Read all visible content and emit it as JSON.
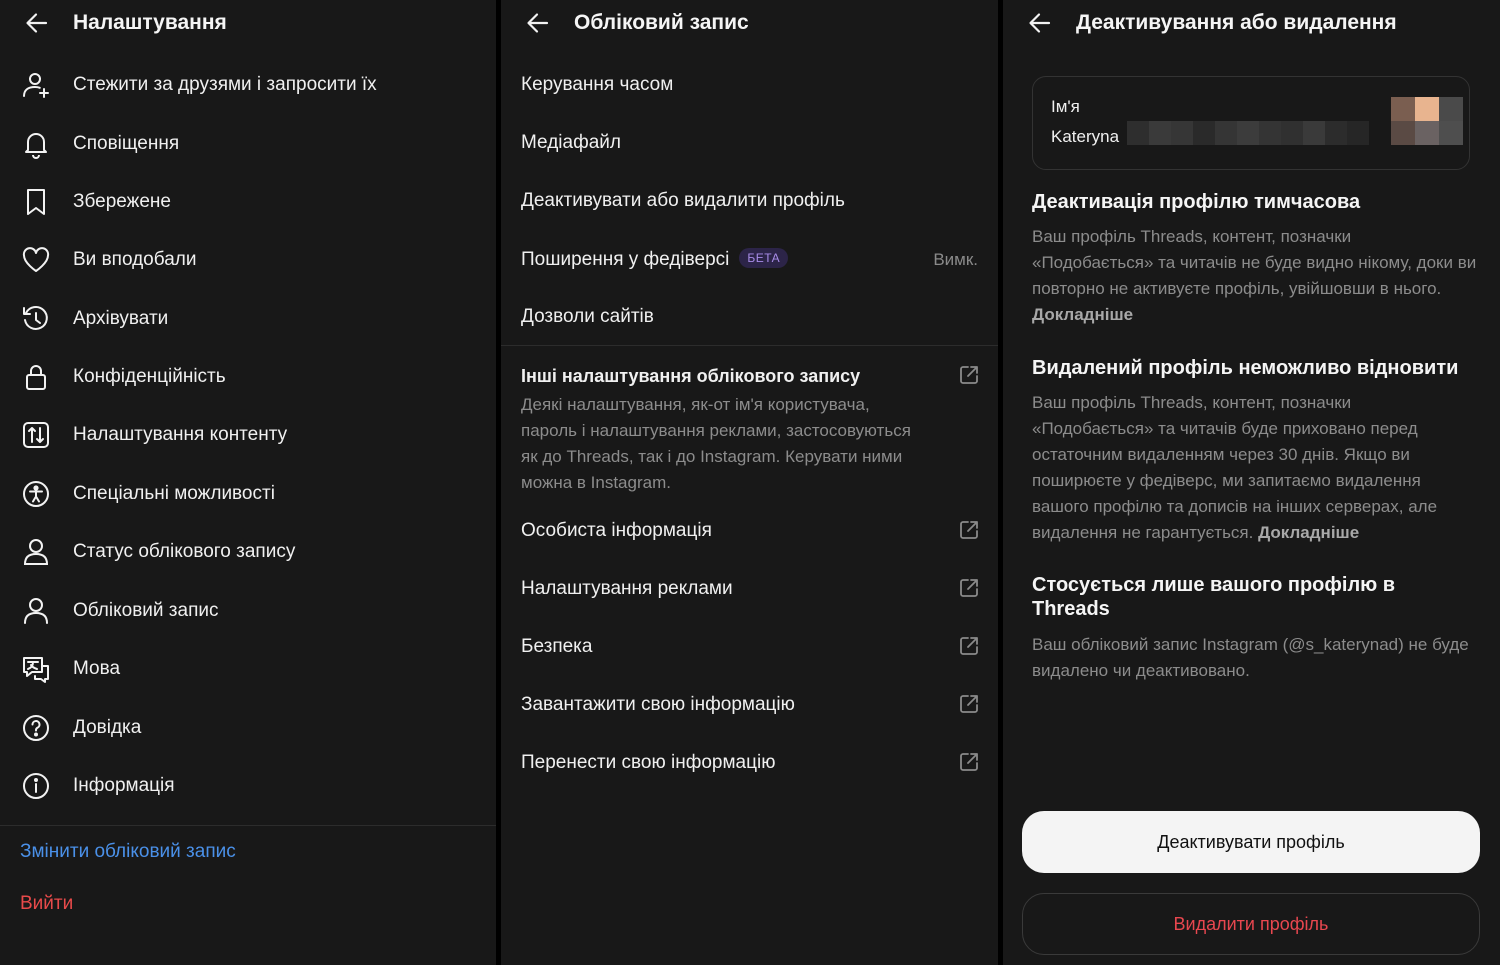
{
  "settings": {
    "title": "Налаштування",
    "items": [
      {
        "label": "Стежити за друзями і запросити їх",
        "icon": "add-person-icon"
      },
      {
        "label": "Сповіщення",
        "icon": "bell-icon"
      },
      {
        "label": "Збережене",
        "icon": "bookmark-icon"
      },
      {
        "label": "Ви вподобали",
        "icon": "heart-icon"
      },
      {
        "label": "Архівувати",
        "icon": "archive-history-icon"
      },
      {
        "label": "Конфіденційність",
        "icon": "lock-icon"
      },
      {
        "label": "Налаштування контенту",
        "icon": "content-settings-icon"
      },
      {
        "label": "Спеціальні можливості",
        "icon": "accessibility-icon"
      },
      {
        "label": "Статус облікового запису",
        "icon": "account-status-icon"
      },
      {
        "label": "Обліковий запис",
        "icon": "account-icon"
      },
      {
        "label": "Мова",
        "icon": "language-icon"
      },
      {
        "label": "Довідка",
        "icon": "help-icon"
      },
      {
        "label": "Інформація",
        "icon": "info-icon"
      }
    ],
    "switch_account": "Змінити обліковий запис",
    "logout": "Вийти"
  },
  "account": {
    "title": "Обліковий запис",
    "items": [
      {
        "label": "Керування часом"
      },
      {
        "label": "Медіафайл"
      },
      {
        "label": "Деактивувати або видалити профіль"
      },
      {
        "label": "Поширення у федіверсі",
        "badge": "БЕТА",
        "value": "Вимк."
      },
      {
        "label": "Дозволи сайтів"
      }
    ],
    "other_title": "Інші налаштування облікового запису",
    "other_desc": "Деякі налаштування, як-от ім'я користувача, пароль і налаштування реклами, застосовуються як до Threads, так і до Instagram. Керувати ними можна в Instagram.",
    "external_items": [
      {
        "label": "Особиста інформація"
      },
      {
        "label": "Налаштування реклами"
      },
      {
        "label": "Безпека"
      },
      {
        "label": "Завантажити свою інформацію"
      },
      {
        "label": "Перенести свою інформацію"
      }
    ]
  },
  "deactivate": {
    "title": "Деактивування або видалення",
    "card_label": "Ім'я",
    "card_name": "Kateryna",
    "section1_title": "Деактивація профілю тимчасова",
    "section1_text": "Ваш профіль Threads, контент, позначки «Подобається» та читачів не буде видно нікому, доки ви повторно не активуєте профіль, увійшовши в нього.",
    "section2_title": "Видалений профіль неможливо відновити",
    "section2_text": "Ваш профіль Threads, контент, позначки «Подобається» та читачів буде приховано перед остаточним видаленням через 30 днів. Якщо ви поширюєте у федіверс, ми запитаємо видалення вашого профілю та дописів на інших серверах, але видалення не гарантується.",
    "learn_more": "Докладніше",
    "section3_title": "Стосується лише вашого профілю в Threads",
    "section3_text": "Ваш обліковий запис Instagram (@s_katerynad) не буде видалено чи деактивовано.",
    "deactivate_button": "Деактивувати профіль",
    "delete_button": "Видалити профіль"
  },
  "colors": {
    "background": "#181818",
    "link_blue": "#4a90e8",
    "danger_red": "#e84a4a",
    "beta_text": "#a88ce8"
  }
}
